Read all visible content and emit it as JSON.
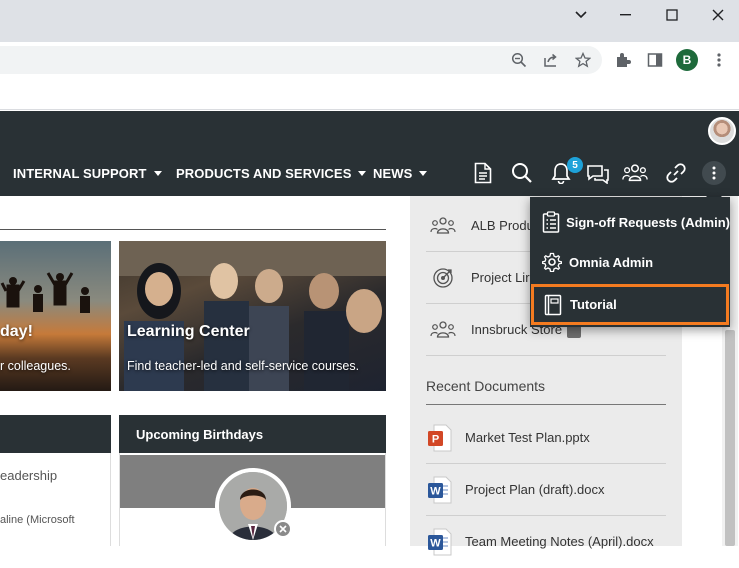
{
  "browser": {
    "profile_initial": "B"
  },
  "nav": {
    "items": [
      {
        "label": "INTERNAL SUPPORT"
      },
      {
        "label": "PRODUCTS AND SERVICES"
      },
      {
        "label": "NEWS"
      }
    ],
    "notification_count": "5"
  },
  "hero": {
    "left": {
      "title": "day!",
      "subtitle": "r colleagues."
    },
    "right": {
      "title": "Learning Center",
      "subtitle": "Find teacher-led and self-service courses."
    }
  },
  "panels": {
    "left": {
      "text1": "eadership",
      "text2": "aline (Microsoft"
    },
    "birthdays": {
      "title": "Upcoming Birthdays"
    }
  },
  "right_column": {
    "items": [
      {
        "label": "ALB Produ",
        "icon": "group-icon"
      },
      {
        "label": "Project Lir",
        "icon": "target-icon"
      },
      {
        "label": "Innsbruck Store",
        "icon": "group-icon"
      }
    ],
    "recent_documents_title": "Recent Documents",
    "documents": [
      {
        "name": "Market Test Plan.pptx",
        "type": "pptx"
      },
      {
        "name": "Project Plan (draft).docx",
        "type": "docx"
      },
      {
        "name": "Team Meeting Notes (April).docx",
        "type": "docx"
      }
    ]
  },
  "dropdown": {
    "items": [
      {
        "label": "Sign-off Requests (Admin)",
        "icon": "clipboard-list-icon"
      },
      {
        "label": "Omnia Admin",
        "icon": "gear-icon"
      },
      {
        "label": "Tutorial",
        "icon": "book-icon"
      }
    ],
    "highlight_color": "#f47b20"
  },
  "colors": {
    "header_bg": "#293135",
    "badge": "#1ea2d9",
    "word_blue": "#2b579a",
    "ppt_orange": "#d24726"
  }
}
